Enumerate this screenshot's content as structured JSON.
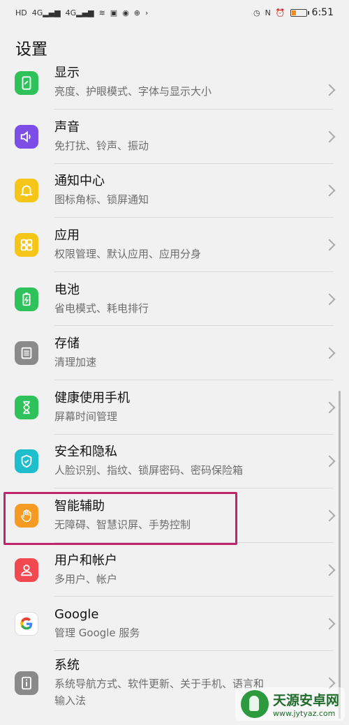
{
  "status_bar": {
    "left_indicators": [
      "HD",
      "4G",
      "4G",
      "wifi",
      "briefcase",
      "sim",
      "nfc-app",
      "arrow"
    ],
    "right_indicators": [
      "alarm",
      "nfc",
      "clock"
    ],
    "battery_level": 0.28,
    "time": "6:51"
  },
  "header": {
    "title": "设置"
  },
  "items": [
    {
      "title": "显示",
      "subtitle": "亮度、护眼模式、字体与显示大小",
      "icon": "display-icon",
      "color": "#2fc25b"
    },
    {
      "title": "声音",
      "subtitle": "免打扰、铃声、振动",
      "icon": "speaker-icon",
      "color": "#7d4ee7"
    },
    {
      "title": "通知中心",
      "subtitle": "图标角标、锁屏通知",
      "icon": "bell-icon",
      "color": "#f5c618"
    },
    {
      "title": "应用",
      "subtitle": "权限管理、默认应用、应用分身",
      "icon": "grid-icon",
      "color": "#f5c618"
    },
    {
      "title": "电池",
      "subtitle": "省电模式、耗电排行",
      "icon": "battery-icon",
      "color": "#2fc25b"
    },
    {
      "title": "存储",
      "subtitle": "清理加速",
      "icon": "storage-icon",
      "color": "#8a8a8a"
    },
    {
      "title": "健康使用手机",
      "subtitle": "屏幕时间管理",
      "icon": "hourglass-icon",
      "color": "#2fc25b"
    },
    {
      "title": "安全和隐私",
      "subtitle": "人脸识别、指纹、锁屏密码、密码保险箱",
      "icon": "shield-icon",
      "color": "#1fbecd"
    },
    {
      "title": "智能辅助",
      "subtitle": "无障碍、智慧识屏、手势控制",
      "icon": "hand-icon",
      "color": "#f59a23"
    },
    {
      "title": "用户和帐户",
      "subtitle": "多用户、帐户",
      "icon": "user-icon",
      "color": "#f2484f"
    },
    {
      "title": "Google",
      "subtitle": "管理 Google 服务",
      "icon": "google-icon",
      "color": "#ffffff"
    },
    {
      "title": "系统",
      "subtitle": "系统导航方式、软件更新、关于手机、语言和",
      "subtitle2": "输入法",
      "icon": "info-icon",
      "color": "#8a8a8a"
    }
  ],
  "watermark": {
    "name": "天源安卓网",
    "url": "www.jytyaz.com"
  }
}
